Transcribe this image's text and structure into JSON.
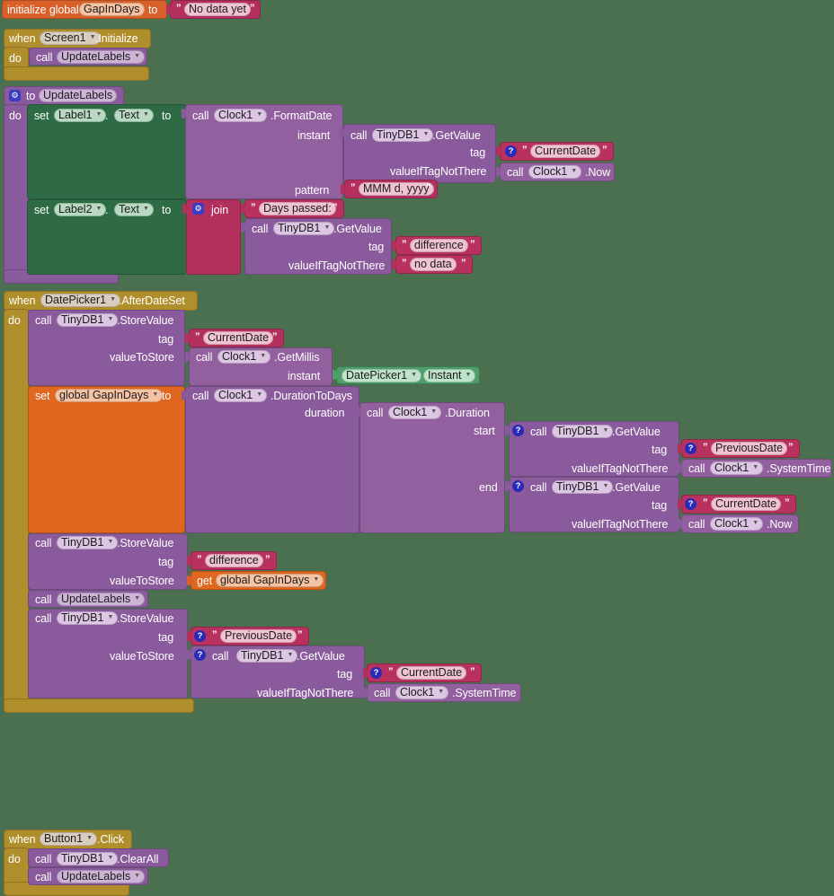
{
  "app": {
    "editor": "MIT App Inventor Blocks Editor",
    "background_color": "#4a7050"
  },
  "colors": {
    "event_gold": "#b08e2c",
    "procedure_purple": "#8a5b9c",
    "method_purple": "#92609f",
    "setter_green": "#2e6b45",
    "getter_green": "#4f9d69",
    "variable_orange": "#d8602a",
    "text_magenta": "#b22f5e",
    "mutator_blue": "#3b3bc4"
  },
  "blocks": {
    "init_global": {
      "keyword": "initialize global",
      "name": "GapInDays",
      "to": "to",
      "value_text": "No data yet"
    },
    "screen_init": {
      "when": "when",
      "component": "Screen1",
      "event": ".Initialize",
      "do": "do",
      "call": "call",
      "procedure": "UpdateLabels"
    },
    "update_labels_proc": {
      "to": "to",
      "name": "UpdateLabels",
      "do": "do",
      "set1": {
        "set": "set",
        "component": "Label1",
        "property": "Text",
        "to": "to",
        "call": "call",
        "clock": "Clock1",
        "method": ".FormatDate",
        "instant_label": "instant",
        "instant_call": "call",
        "instant_component": "TinyDB1",
        "instant_method": ".GetValue",
        "tag_label": "tag",
        "tag_value": "CurrentDate",
        "vitnt_label": "valueIfTagNotThere",
        "vitnt_call": "call",
        "vitnt_component": "Clock1",
        "vitnt_method": ".Now",
        "pattern_label": "pattern",
        "pattern_value": "MMM d, yyyy"
      },
      "set2": {
        "set": "set",
        "component": "Label2",
        "property": "Text",
        "to": "to",
        "join": "join",
        "text1": "Days passed:",
        "call": "call",
        "component2": "TinyDB1",
        "method": ".GetValue",
        "tag_label": "tag",
        "tag_value": "difference",
        "vitnt_label": "valueIfTagNotThere",
        "vitnt_value": "no data"
      }
    },
    "after_date_set": {
      "when": "when",
      "component": "DatePicker1",
      "event": ".AfterDateSet",
      "do": "do",
      "store_current": {
        "call": "call",
        "component": "TinyDB1",
        "method": ".StoreValue",
        "tag_label": "tag",
        "tag_value": "CurrentDate",
        "vts_label": "valueToStore",
        "vts_call": "call",
        "vts_component": "Clock1",
        "vts_method": ".GetMillis",
        "instant_label": "instant",
        "instant_component": "DatePicker1",
        "instant_property": "Instant"
      },
      "set_gap": {
        "set": "set",
        "variable": "global GapInDays",
        "to": "to",
        "call": "call",
        "clock": "Clock1",
        "method": ".DurationToDays",
        "duration_label": "duration",
        "dur_call": "call",
        "dur_component": "Clock1",
        "dur_method": ".Duration",
        "start_label": "start",
        "start_call": "call",
        "start_component": "TinyDB1",
        "start_method": ".GetValue",
        "start_tag_label": "tag",
        "start_tag_value": "PreviousDate",
        "start_vitnt_label": "valueIfTagNotThere",
        "start_vitnt_call": "call",
        "start_vitnt_component": "Clock1",
        "start_vitnt_method": ".SystemTime",
        "end_label": "end",
        "end_call": "call",
        "end_component": "TinyDB1",
        "end_method": ".GetValue",
        "end_tag_label": "tag",
        "end_tag_value": "CurrentDate",
        "end_vitnt_label": "valueIfTagNotThere",
        "end_vitnt_call": "call",
        "end_vitnt_component": "Clock1",
        "end_vitnt_method": ".Now"
      },
      "store_difference": {
        "call": "call",
        "component": "TinyDB1",
        "method": ".StoreValue",
        "tag_label": "tag",
        "tag_value": "difference",
        "vts_label": "valueToStore",
        "get": "get",
        "get_variable": "global GapInDays"
      },
      "call_update": {
        "call": "call",
        "procedure": "UpdateLabels"
      },
      "store_previous": {
        "call": "call",
        "component": "TinyDB1",
        "method": ".StoreValue",
        "tag_label": "tag",
        "tag_value": "PreviousDate",
        "vts_label": "valueToStore",
        "vts_call": "call",
        "vts_component": "TinyDB1",
        "vts_method": ".GetValue",
        "inner_tag_label": "tag",
        "inner_tag_value": "CurrentDate",
        "inner_vitnt_label": "valueIfTagNotThere",
        "inner_vitnt_call": "call",
        "inner_vitnt_component": "Clock1",
        "inner_vitnt_method": ".SystemTime"
      }
    },
    "button_click": {
      "when": "when",
      "component": "Button1",
      "event": ".Click",
      "do": "do",
      "clear": {
        "call": "call",
        "component": "TinyDB1",
        "method": ".ClearAll"
      },
      "update": {
        "call": "call",
        "procedure": "UpdateLabels"
      }
    }
  },
  "icons": {
    "gear": "⚙",
    "help": "?",
    "caret": "▼"
  }
}
